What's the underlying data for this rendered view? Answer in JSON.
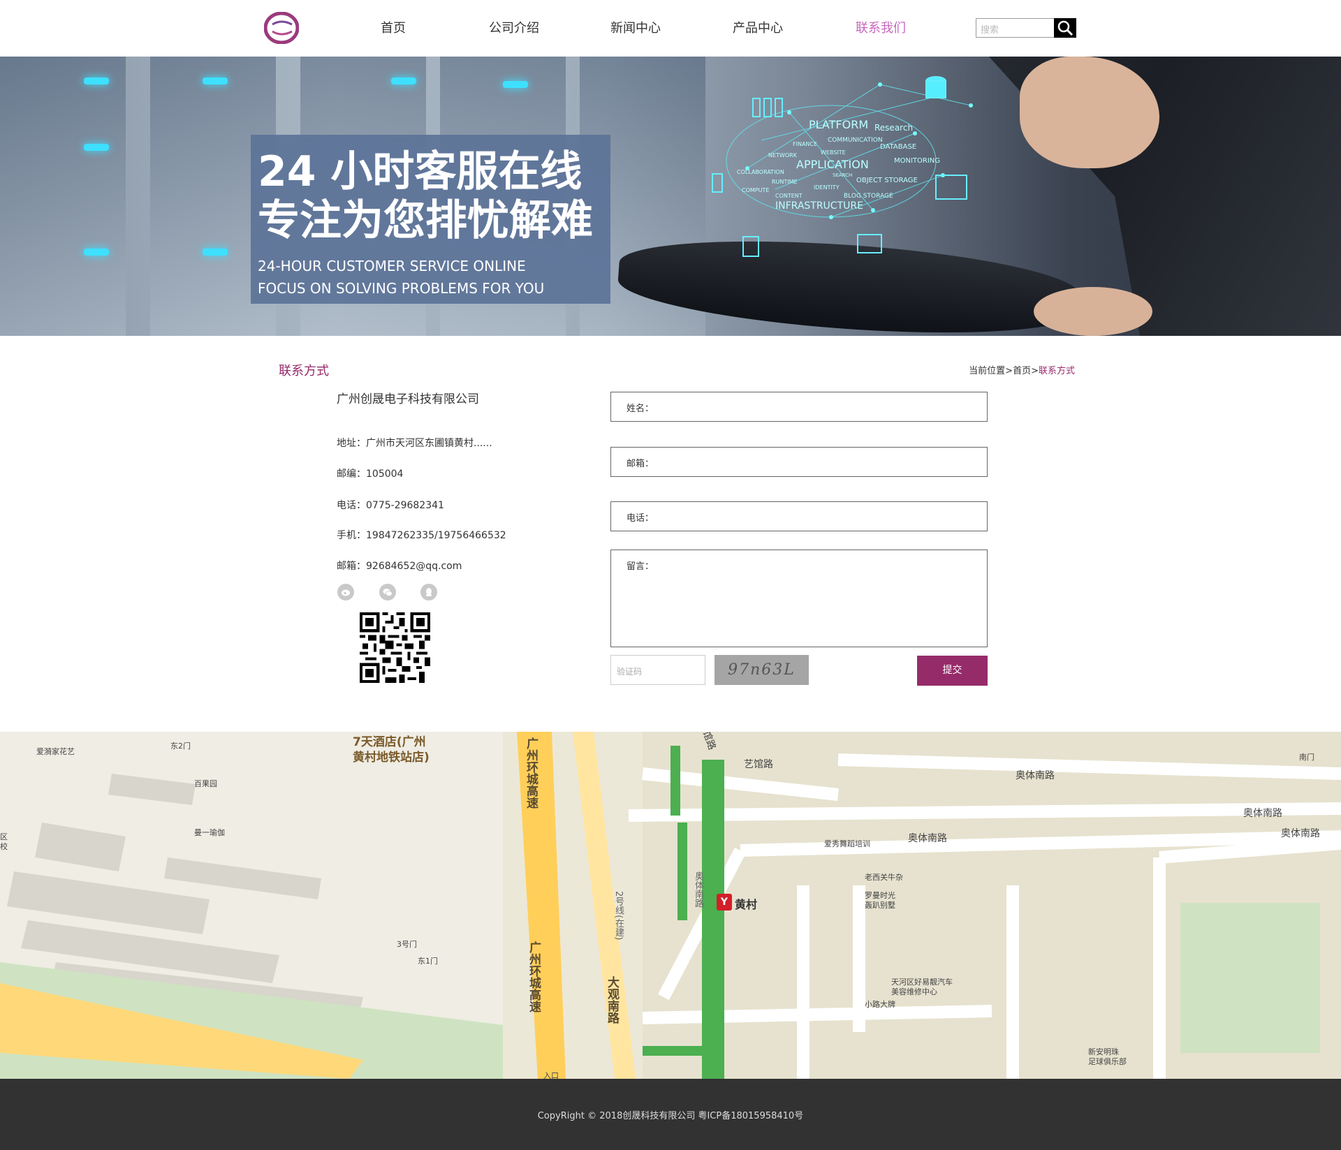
{
  "header": {
    "nav": [
      {
        "label": "首页"
      },
      {
        "label": "公司介绍"
      },
      {
        "label": "新闻中心"
      },
      {
        "label": "产品中心"
      },
      {
        "label": "联系我们",
        "active": true
      }
    ],
    "search_placeholder": "搜索",
    "brand_color": "#962b6a"
  },
  "banner": {
    "line1": "24 小时客服在线",
    "line2": "专注为您排忧解难",
    "en1": "24-HOUR CUSTOMER SERVICE ONLINE",
    "en2": "FOCUS ON SOLVING PROBLEMS FOR YOU",
    "net_words": [
      "PLATFORM",
      "Research",
      "COMMUNICATION",
      "FINANCE",
      "NETWORK",
      "WEBSITE",
      "DATABASE",
      "APPLICATION",
      "MONITORING",
      "COLLABORATION",
      "SEARCH",
      "RUNTIME",
      "OBJECT STORAGE",
      "IDENTITY",
      "COMPUTE",
      "CONTENT",
      "BLOG STORAGE",
      "INFRASTRUCTURE"
    ]
  },
  "contact": {
    "section_title": "联系方式",
    "breadcrumb": {
      "prefix": "当前位置",
      "sep": ">",
      "home": "首页",
      "current": "联系方式"
    },
    "company": "广州创晟电子科技有限公司",
    "address": "地址：广州市天河区东圃镇黄村......",
    "postcode": "邮编：105004",
    "phone": "电话：0775-29682341",
    "mobile": "手机：19847262335/19756466532",
    "email": "邮箱：92684652@qq.com",
    "social": [
      "weibo-icon",
      "wechat-icon",
      "qq-icon"
    ]
  },
  "form": {
    "name_label": "姓名：",
    "email_label": "邮箱：",
    "phone_label": "电话：",
    "message_label": "留言：",
    "captcha_placeholder": "验证码",
    "captcha_text": "97n63L",
    "submit_label": "提交"
  },
  "map": {
    "labels": {
      "hotel": "7天酒店(广州",
      "hotel2": "黄村地铁站店)",
      "aiyu": "爱漪家花艺",
      "east2": "东2门",
      "baiguoyuan": "百果园",
      "manyi": "曼一瑜伽",
      "gate3": "3号门",
      "east1": "东1门",
      "ring1": "广州环城高速",
      "ring2": "广州环城高速",
      "line2": "2号线(在建)",
      "daguan": "大观南路",
      "guanlu": "馆路",
      "yiguan": "艺馆路",
      "aotinan1": "奥体南路",
      "aotinan2": "奥体南路",
      "aotinan3": "奥体南路",
      "aotinan4": "奥体南路",
      "aotinanv": "奥体南路",
      "south_gate": "南门",
      "aixiu": "爱秀舞蹈培训",
      "laoxi": "老西关牛杂",
      "luoman1": "罗曼时光",
      "luoman2": "轰趴别墅",
      "huangcun": "黄村",
      "haoyi1": "天河区好易靓汽车",
      "haoyi2": "美容维修中心",
      "xiaolu": "小路大牌",
      "xinan1": "新安明珠",
      "xinan2": "足球俱乐部",
      "district": "区",
      "school": "校",
      "entrance": "入口"
    }
  },
  "footer": {
    "copyright": "CopyRight © 2018创晟科技有限公司 粤ICP备18015958410号"
  }
}
